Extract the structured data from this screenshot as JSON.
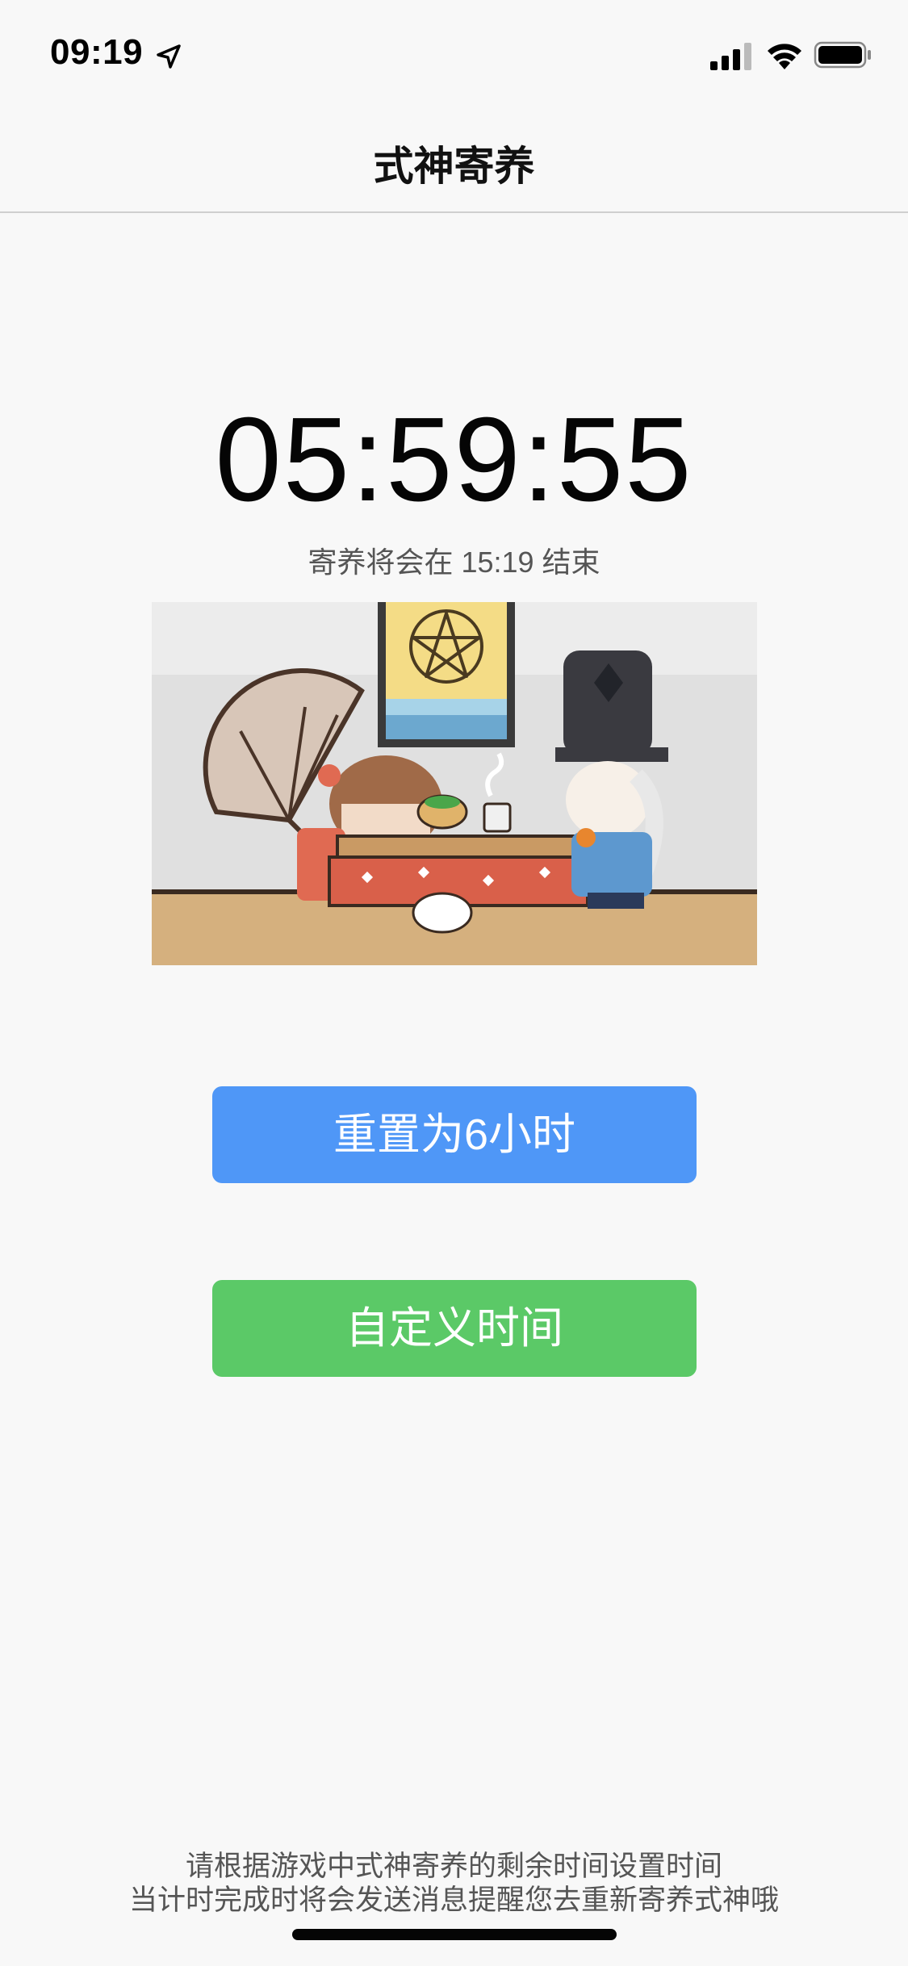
{
  "status_bar": {
    "time": "09:19",
    "icons": [
      "location-arrow-icon",
      "cellular-signal-icon",
      "wifi-icon",
      "battery-icon"
    ]
  },
  "nav": {
    "title": "式神寄养"
  },
  "timer": {
    "remaining": "05:59:55",
    "end_text": "寄养将会在 15:19 结束"
  },
  "illustration": {
    "description_icon": "shikigami-kotatsu-illustration"
  },
  "buttons": {
    "reset_label": "重置为6小时",
    "custom_label": "自定义时间"
  },
  "footer": {
    "line1": "请根据游戏中式神寄养的剩余时间设置时间",
    "line2": "当计时完成时将会发送消息提醒您去重新寄养式神哦"
  },
  "colors": {
    "reset_button": "#4f97f7",
    "custom_button": "#5bc967",
    "background": "#f8f8f8"
  }
}
